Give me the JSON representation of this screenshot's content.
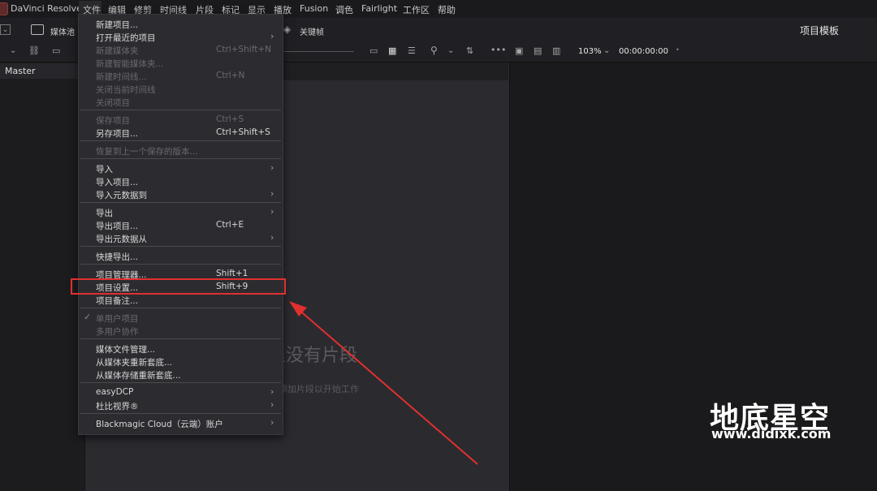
{
  "app": {
    "title": "DaVinci Resolve"
  },
  "menubar": {
    "items": [
      "文件",
      "编辑",
      "修剪",
      "时间线",
      "片段",
      "标记",
      "显示",
      "播放",
      "Fusion",
      "调色",
      "Fairlight",
      "工作区",
      "帮助"
    ]
  },
  "toolbar": {
    "media_pool": "媒体池",
    "keyframes": "关键帧",
    "project_templates": "项目模板",
    "zoom": "103%",
    "timecode": "00:00:00:00"
  },
  "bin": {
    "master": "Master"
  },
  "viewer": {
    "empty_title": "里没有片段",
    "empty_subtitle": "添加片段以开始工作"
  },
  "file_menu": {
    "items": [
      {
        "label": "新建项目...",
        "shortcut": "",
        "submenu": false,
        "enabled": true
      },
      {
        "label": "打开最近的项目",
        "shortcut": "",
        "submenu": true,
        "enabled": true
      },
      {
        "label": "新建媒体夹",
        "shortcut": "Ctrl+Shift+N",
        "submenu": false,
        "enabled": false
      },
      {
        "label": "新建智能媒体夹...",
        "shortcut": "",
        "submenu": false,
        "enabled": false
      },
      {
        "label": "新建时间线...",
        "shortcut": "Ctrl+N",
        "submenu": false,
        "enabled": false
      },
      {
        "label": "关闭当前时间线",
        "shortcut": "",
        "submenu": false,
        "enabled": false
      },
      {
        "label": "关闭项目",
        "shortcut": "",
        "submenu": false,
        "enabled": false
      },
      {
        "label": "保存项目",
        "shortcut": "Ctrl+S",
        "submenu": false,
        "enabled": false
      },
      {
        "label": "另存项目...",
        "shortcut": "Ctrl+Shift+S",
        "submenu": false,
        "enabled": true
      },
      {
        "label": "恢复到上一个保存的版本...",
        "shortcut": "",
        "submenu": false,
        "enabled": false
      },
      {
        "label": "导入",
        "shortcut": "",
        "submenu": true,
        "enabled": true
      },
      {
        "label": "导入项目...",
        "shortcut": "",
        "submenu": false,
        "enabled": true
      },
      {
        "label": "导入元数据到",
        "shortcut": "",
        "submenu": true,
        "enabled": true
      },
      {
        "label": "导出",
        "shortcut": "",
        "submenu": true,
        "enabled": true
      },
      {
        "label": "导出项目...",
        "shortcut": "Ctrl+E",
        "submenu": false,
        "enabled": true
      },
      {
        "label": "导出元数据从",
        "shortcut": "",
        "submenu": true,
        "enabled": true
      },
      {
        "label": "快捷导出...",
        "shortcut": "",
        "submenu": false,
        "enabled": true
      },
      {
        "label": "项目管理器...",
        "shortcut": "Shift+1",
        "submenu": false,
        "enabled": true
      },
      {
        "label": "项目设置...",
        "shortcut": "Shift+9",
        "submenu": false,
        "enabled": true
      },
      {
        "label": "项目备注...",
        "shortcut": "",
        "submenu": false,
        "enabled": true
      },
      {
        "label": "单用户项目",
        "shortcut": "",
        "submenu": false,
        "enabled": false,
        "checked": true
      },
      {
        "label": "多用户协作",
        "shortcut": "",
        "submenu": false,
        "enabled": false
      },
      {
        "label": "媒体文件管理...",
        "shortcut": "",
        "submenu": false,
        "enabled": true
      },
      {
        "label": "从媒体夹重新套底...",
        "shortcut": "",
        "submenu": false,
        "enabled": true
      },
      {
        "label": "从媒体存储重新套底...",
        "shortcut": "",
        "submenu": false,
        "enabled": true
      },
      {
        "label": "easyDCP",
        "shortcut": "",
        "submenu": true,
        "enabled": true
      },
      {
        "label": "杜比视界®",
        "shortcut": "",
        "submenu": true,
        "enabled": true
      },
      {
        "label": "Blackmagic Cloud（云端）账户",
        "shortcut": "",
        "submenu": true,
        "enabled": true
      }
    ]
  },
  "watermark": {
    "main": "地底星空",
    "sub": "www.didixk.com"
  },
  "colors": {
    "highlight": "#e0302f",
    "arrow": "#e0302f"
  }
}
